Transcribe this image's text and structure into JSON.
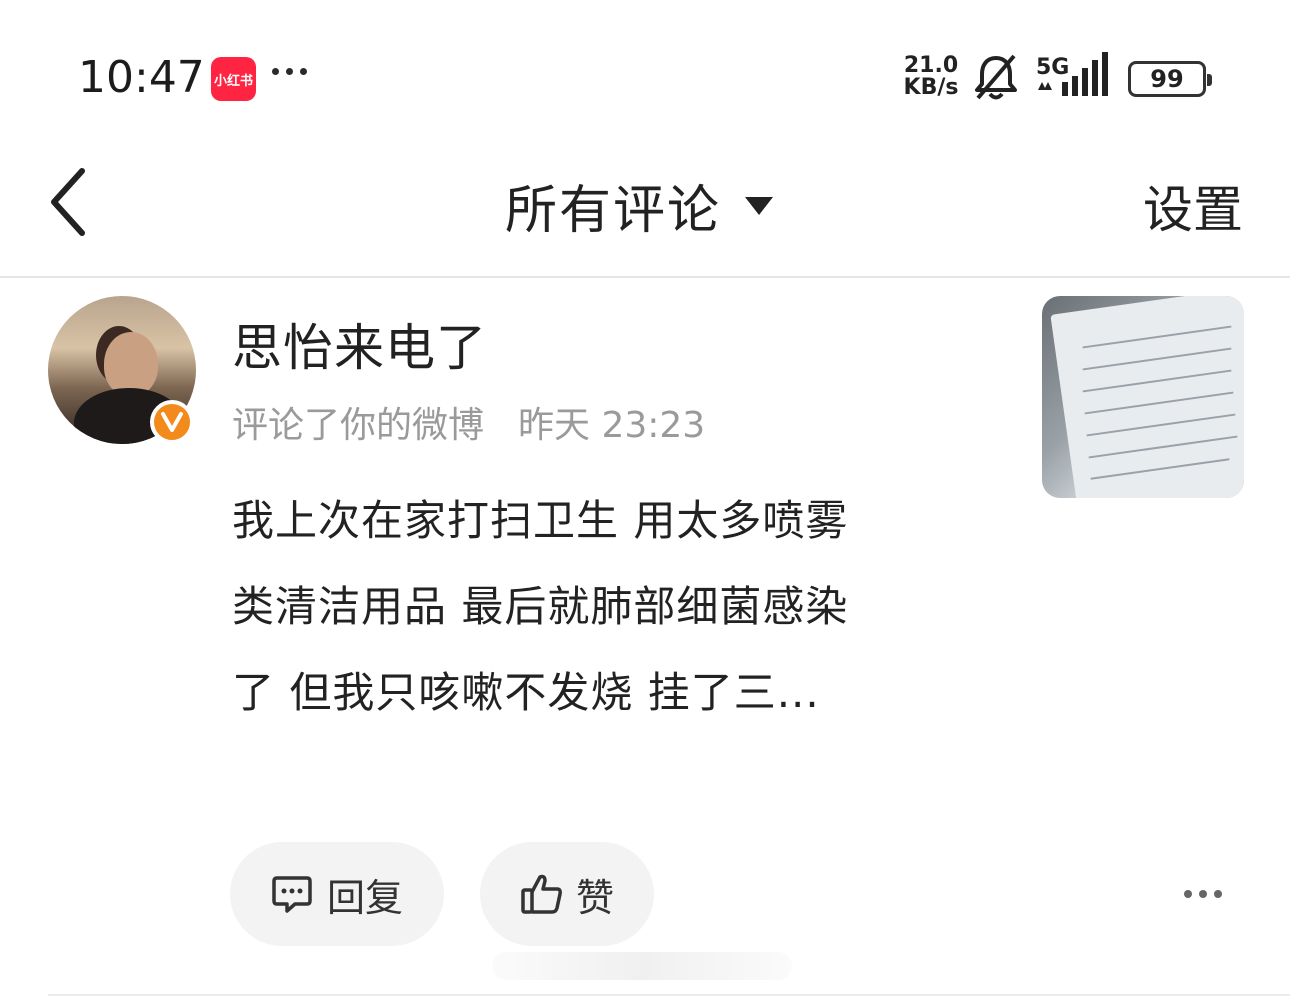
{
  "status_bar": {
    "time": "10:47",
    "app_badge_text": "小红书",
    "app_badge_color": "#ff2442",
    "net_speed_value": "21.0",
    "net_speed_unit": "KB/s",
    "network_type": "5G",
    "battery": "99",
    "icons": [
      "notifications-muted-icon",
      "signal-icon",
      "battery-icon"
    ]
  },
  "header": {
    "title": "所有评论",
    "settings_label": "设置",
    "back_icon": "chevron-left-icon",
    "dropdown_icon": "caret-down-icon"
  },
  "comment": {
    "username": "思怡来电了",
    "action": "评论了你的微博",
    "time": "昨天 23:23",
    "verified_color": "#f28a1c",
    "text_lines": [
      "我上次在家打扫卫生 用太多喷雾",
      "类清洁用品 最后就肺部细菌感染",
      "了 但我只咳嗽不发烧 挂了三..."
    ],
    "reply_label": "回复",
    "like_label": "赞"
  }
}
